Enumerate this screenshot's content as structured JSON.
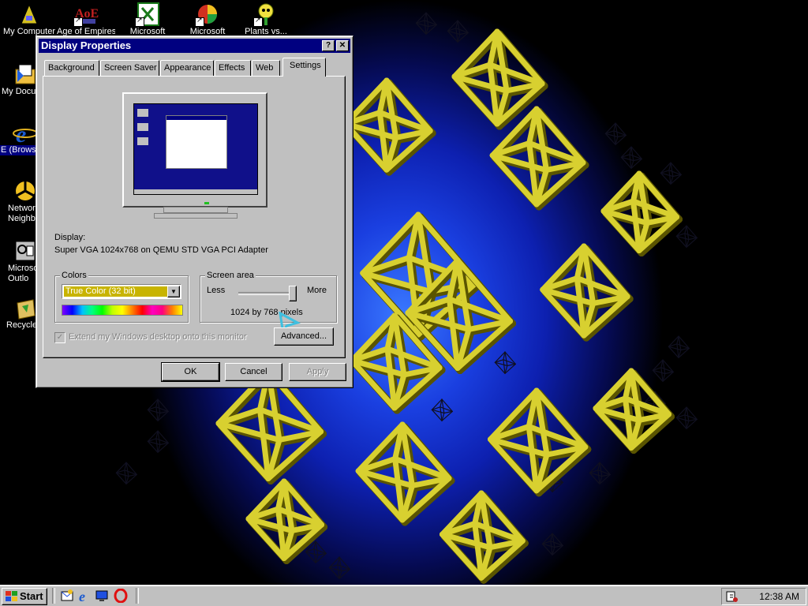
{
  "desktop": {
    "icons": [
      {
        "label": "My Computer",
        "icon": "my-computer-icon"
      },
      {
        "label": "Age of Empires",
        "icon": "age-of-empires-icon"
      },
      {
        "label": "Microsoft",
        "icon": "excel-icon"
      },
      {
        "label": "Microsoft",
        "icon": "powerpoint-icon"
      },
      {
        "label": "Plants vs...",
        "icon": "plants-vs-zombies-icon"
      },
      {
        "label": "My Docu",
        "icon": "my-documents-icon"
      },
      {
        "label": "IE (Browser",
        "icon": "internet-explorer-icon"
      },
      {
        "label": "Network Neighbo",
        "icon": "network-neighborhood-icon"
      },
      {
        "label": "Microsoft Outlo",
        "icon": "outlook-icon"
      },
      {
        "label": "Recycle",
        "icon": "recycle-bin-icon"
      }
    ]
  },
  "window": {
    "title": "Display Properties",
    "help_btn": "?",
    "close_btn": "✕",
    "tabs": [
      "Background",
      "Screen Saver",
      "Appearance",
      "Effects",
      "Web",
      "Settings"
    ],
    "active_tab": "Settings",
    "display_label": "Display:",
    "display_value": "Super VGA 1024x768 on QEMU STD VGA PCI Adapter",
    "colors_label": "Colors",
    "colors_value": "True Color (32 bit)",
    "screen_area_label": "Screen area",
    "less_label": "Less",
    "more_label": "More",
    "resolution_text": "1024 by 768 pixels",
    "slider_level": 1.0,
    "extend_label": "Extend my Windows desktop onto this monitor",
    "advanced_btn": "Advanced...",
    "ok_btn": "OK",
    "cancel_btn": "Cancel",
    "apply_btn": "Apply"
  },
  "taskbar": {
    "start_label": "Start",
    "quicklaunch": [
      "outlook-express-icon",
      "internet-explorer-icon",
      "show-desktop-icon",
      "opera-icon"
    ],
    "clock": "12:38 AM"
  },
  "colors": {
    "titlebar": "#000080",
    "face": "#c0c0c0",
    "select_highlight": "#c8b400"
  }
}
